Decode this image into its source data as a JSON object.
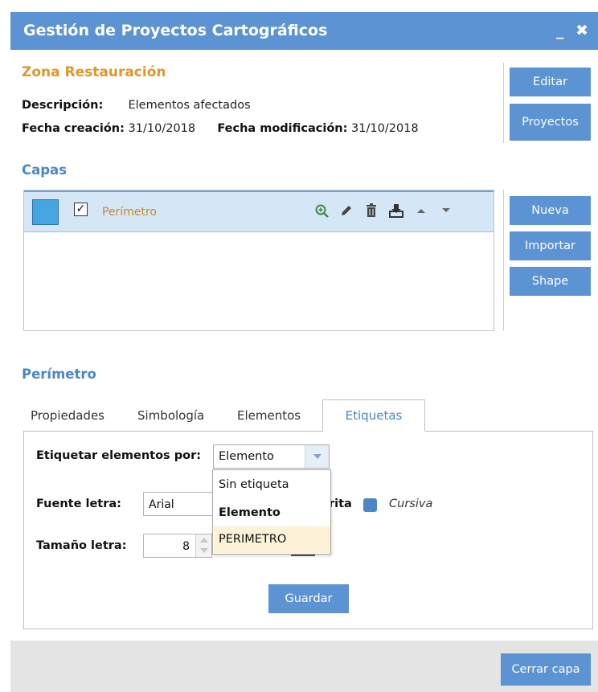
{
  "window": {
    "title": "Gestión de Proyectos Cartográficos",
    "controls": "_ ✖"
  },
  "project": {
    "name": "Zona Restauración",
    "description_label": "Descripción:",
    "description_value": "Elementos afectados",
    "created_label": "Fecha creación:",
    "created_value": "31/10/2018",
    "modified_label": "Fecha modificación:",
    "modified_value": "31/10/2018",
    "edit_button": "Editar",
    "projects_button": "Proyectos"
  },
  "layers": {
    "section_title": "Capas",
    "items": [
      {
        "name": "Perímetro",
        "checked": true,
        "color": "#45a6e2"
      }
    ],
    "new_button": "Nueva",
    "import_button": "Importar",
    "shape_button": "Shape"
  },
  "layer_detail": {
    "title": "Perímetro",
    "tabs": [
      "Propiedades",
      "Simbología",
      "Elementos",
      "Etiquetas"
    ],
    "active_tab": "Etiquetas",
    "label_by_label": "Etiquetar elementos por:",
    "label_by_value": "Elemento",
    "dropdown_options": [
      "Sin etiqueta",
      "Elemento",
      "PERIMETRO"
    ],
    "font_label": "Fuente letra:",
    "font_value": "Arial",
    "bold_fragment": "rita",
    "italic_label": "Cursiva",
    "size_label": "Tamaño letra:",
    "size_value": "8",
    "save_button": "Guardar"
  },
  "footer": {
    "close_layer_button": "Cerrar capa"
  },
  "colors": {
    "accent": "#5b93d3",
    "project_name": "#e0962a",
    "section": "#4c86c6",
    "selected_row": "#d5e7f7",
    "highlight_option": "#fdf1d8"
  }
}
